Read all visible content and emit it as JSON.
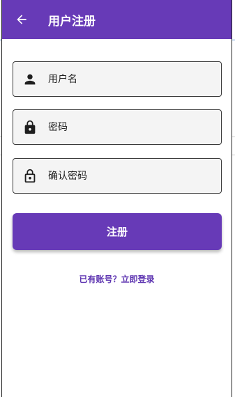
{
  "app": {
    "title": "用户注册",
    "theme_color": "#673ab7",
    "link_color": "#5e35b1"
  },
  "appbar": {
    "back_icon": "arrow-back-icon"
  },
  "form": {
    "username": {
      "placeholder": "用户名",
      "value": "",
      "icon": "person-icon"
    },
    "password": {
      "placeholder": "密码",
      "value": "",
      "icon": "lock-filled-icon"
    },
    "confirm_password": {
      "placeholder": "确认密码",
      "value": "",
      "icon": "lock-outline-icon"
    },
    "submit_label": "注册",
    "login_link": "已有账号？立即登录"
  }
}
